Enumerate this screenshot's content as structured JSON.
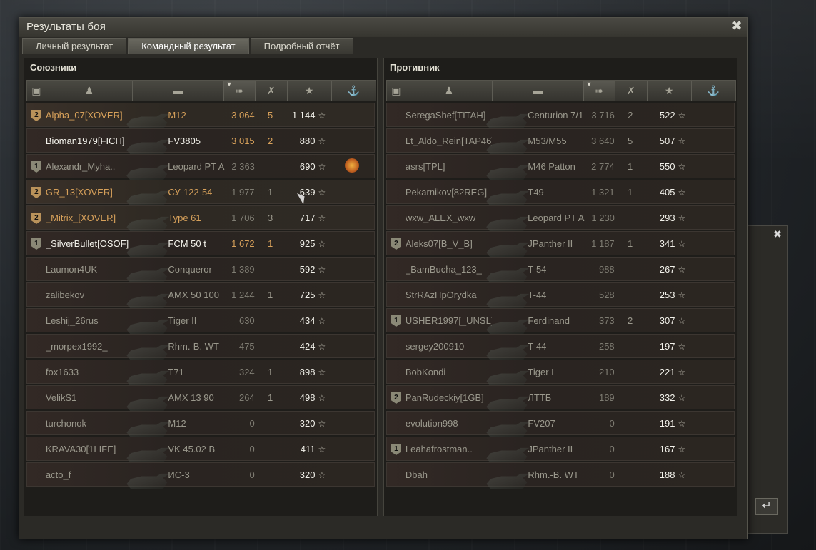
{
  "window": {
    "title": "Результаты боя"
  },
  "tabs": [
    "Личный результат",
    "Командный результат",
    "Подробный отчёт"
  ],
  "active_tab": 1,
  "allies": {
    "title": "Союзники",
    "rows": [
      {
        "badge": "2",
        "badge_color": "gold",
        "player": "Alpha_07[XOVER]",
        "player_color": "gold",
        "tank": "M12",
        "tank_color": "gold",
        "damage": "3 064",
        "damage_color": "gold",
        "kills": "5",
        "xp": "1 144",
        "medal": false,
        "highlight": true
      },
      {
        "badge": "",
        "player": "Bioman1979[FICH]",
        "player_color": "white",
        "tank": "FV3805",
        "tank_color": "white",
        "damage": "3 015",
        "damage_color": "gold",
        "kills": "2",
        "xp": "880",
        "medal": false
      },
      {
        "badge": "1",
        "badge_color": "grey",
        "player": "Alexandr_Myha..",
        "player_color": "dim",
        "tank": "Leopard PT A",
        "tank_color": "dim",
        "damage": "2 363",
        "damage_color": "dim",
        "kills": "",
        "xp": "690",
        "medal": true
      },
      {
        "badge": "2",
        "badge_color": "gold",
        "player": "GR_13[XOVER]",
        "player_color": "gold",
        "tank": "СУ-122-54",
        "tank_color": "gold",
        "damage": "1 977",
        "damage_color": "dim",
        "kills": "1",
        "xp": "639",
        "medal": false,
        "highlight": true
      },
      {
        "badge": "2",
        "badge_color": "gold",
        "player": "_Mitrix_[XOVER]",
        "player_color": "gold",
        "tank": "Type 61",
        "tank_color": "gold",
        "damage": "1 706",
        "damage_color": "dim",
        "kills": "3",
        "xp": "717",
        "medal": false,
        "highlight": true
      },
      {
        "badge": "1",
        "badge_color": "grey",
        "player": "_SilverBullet[OSOF]",
        "player_color": "white",
        "tank": "FCM 50 t",
        "tank_color": "white",
        "damage": "1 672",
        "damage_color": "gold",
        "kills": "1",
        "xp": "925",
        "medal": false
      },
      {
        "badge": "",
        "player": "Laumon4UK",
        "player_color": "dim",
        "tank": "Conqueror",
        "tank_color": "dim",
        "damage": "1 389",
        "damage_color": "dim",
        "kills": "",
        "xp": "592",
        "medal": false
      },
      {
        "badge": "",
        "player": "zalibekov",
        "player_color": "dim",
        "tank": "AMX 50 100",
        "tank_color": "dim",
        "damage": "1 244",
        "damage_color": "dim",
        "kills": "1",
        "xp": "725",
        "medal": false
      },
      {
        "badge": "",
        "player": "Leshij_26rus",
        "player_color": "dim",
        "tank": "Tiger II",
        "tank_color": "dim",
        "damage": "630",
        "damage_color": "dim",
        "kills": "",
        "xp": "434",
        "medal": false
      },
      {
        "badge": "",
        "player": "_morpex1992_",
        "player_color": "dim",
        "tank": "Rhm.-B. WT",
        "tank_color": "dim",
        "damage": "475",
        "damage_color": "dim",
        "kills": "",
        "xp": "424",
        "medal": false
      },
      {
        "badge": "",
        "player": "fox1633",
        "player_color": "dim",
        "tank": "T71",
        "tank_color": "dim",
        "damage": "324",
        "damage_color": "dim",
        "kills": "1",
        "xp": "898",
        "medal": false
      },
      {
        "badge": "",
        "player": "VelikS1",
        "player_color": "dim",
        "tank": "AMX 13 90",
        "tank_color": "dim",
        "damage": "264",
        "damage_color": "dim",
        "kills": "1",
        "xp": "498",
        "medal": false
      },
      {
        "badge": "",
        "player": "turchonok",
        "player_color": "dim",
        "tank": "M12",
        "tank_color": "dim",
        "damage": "0",
        "damage_color": "dim",
        "kills": "",
        "xp": "320",
        "medal": false
      },
      {
        "badge": "",
        "player": "KRAVA30[1LIFE]",
        "player_color": "dim",
        "tank": "VK 45.02 B",
        "tank_color": "dim",
        "damage": "0",
        "damage_color": "dim",
        "kills": "",
        "xp": "411",
        "medal": false
      },
      {
        "badge": "",
        "player": "acto_f",
        "player_color": "dim",
        "tank": "ИС-3",
        "tank_color": "dim",
        "damage": "0",
        "damage_color": "dim",
        "kills": "",
        "xp": "320",
        "medal": false
      }
    ]
  },
  "enemies": {
    "title": "Противник",
    "rows": [
      {
        "badge": "",
        "player": "SeregaShef[TITAH]",
        "player_color": "dim",
        "tank": "Centurion 7/1",
        "tank_color": "dim",
        "damage": "3 716",
        "damage_color": "dim",
        "kills": "2",
        "xp": "522",
        "medal": false
      },
      {
        "badge": "",
        "player": "Lt_Aldo_Rein[TAP46]",
        "player_color": "dim",
        "tank": "M53/M55",
        "tank_color": "dim",
        "damage": "3 640",
        "damage_color": "dim",
        "kills": "5",
        "xp": "507",
        "medal": false
      },
      {
        "badge": "",
        "player": "asrs[TPL]",
        "player_color": "dim",
        "tank": "M46 Patton",
        "tank_color": "dim",
        "damage": "2 774",
        "damage_color": "dim",
        "kills": "1",
        "xp": "550",
        "medal": false
      },
      {
        "badge": "",
        "player": "Pekarnikov[82REG]",
        "player_color": "dim",
        "tank": "T49",
        "tank_color": "dim",
        "damage": "1 321",
        "damage_color": "dim",
        "kills": "1",
        "xp": "405",
        "medal": false
      },
      {
        "badge": "",
        "player": "wxw_ALEX_wxw",
        "player_color": "dim",
        "tank": "Leopard PT A",
        "tank_color": "dim",
        "damage": "1 230",
        "damage_color": "dim",
        "kills": "",
        "xp": "293",
        "medal": false
      },
      {
        "badge": "2",
        "badge_color": "grey",
        "player": "Aleks07[B_V_B]",
        "player_color": "dim",
        "tank": "JPanther II",
        "tank_color": "dim",
        "damage": "1 187",
        "damage_color": "dim",
        "kills": "1",
        "xp": "341",
        "medal": false
      },
      {
        "badge": "",
        "player": "_BamBucha_123_",
        "player_color": "dim",
        "tank": "T-54",
        "tank_color": "dim",
        "damage": "988",
        "damage_color": "dim",
        "kills": "",
        "xp": "267",
        "medal": false
      },
      {
        "badge": "",
        "player": "StrRAzHpOrydka",
        "player_color": "dim",
        "tank": "T-44",
        "tank_color": "dim",
        "damage": "528",
        "damage_color": "dim",
        "kills": "",
        "xp": "253",
        "medal": false
      },
      {
        "badge": "1",
        "badge_color": "grey",
        "player": "USHER1997[_UNSL]",
        "player_color": "dim",
        "tank": "Ferdinand",
        "tank_color": "dim",
        "damage": "373",
        "damage_color": "dim",
        "kills": "2",
        "xp": "307",
        "medal": false
      },
      {
        "badge": "",
        "player": "sergey200910",
        "player_color": "dim",
        "tank": "T-44",
        "tank_color": "dim",
        "damage": "258",
        "damage_color": "dim",
        "kills": "",
        "xp": "197",
        "medal": false
      },
      {
        "badge": "",
        "player": "BobKondi",
        "player_color": "dim",
        "tank": "Tiger I",
        "tank_color": "dim",
        "damage": "210",
        "damage_color": "dim",
        "kills": "",
        "xp": "221",
        "medal": false
      },
      {
        "badge": "2",
        "badge_color": "grey",
        "player": "PanRudeckiy[1GB]",
        "player_color": "dim",
        "tank": "ЛТТБ",
        "tank_color": "dim",
        "damage": "189",
        "damage_color": "dim",
        "kills": "",
        "xp": "332",
        "medal": false
      },
      {
        "badge": "",
        "player": "evolution998",
        "player_color": "dim",
        "tank": "FV207",
        "tank_color": "dim",
        "damage": "0",
        "damage_color": "dim",
        "kills": "",
        "xp": "191",
        "medal": false
      },
      {
        "badge": "1",
        "badge_color": "grey",
        "player": "Leahafrostman..",
        "player_color": "dim",
        "tank": "JPanther II",
        "tank_color": "dim",
        "damage": "0",
        "damage_color": "dim",
        "kills": "",
        "xp": "167",
        "medal": false
      },
      {
        "badge": "",
        "player": "Dbah",
        "player_color": "dim",
        "tank": "Rhm.-B. WT",
        "tank_color": "dim",
        "damage": "0",
        "damage_color": "dim",
        "kills": "",
        "xp": "188",
        "medal": false
      }
    ]
  },
  "colors": {
    "gold": "#d6a05a",
    "white": "#f2f1ea",
    "dim": "#9a988c",
    "panel": "#1e1d1a"
  },
  "icons": {
    "close": "close-icon",
    "squad": "squad-icon",
    "player": "player-icon",
    "tank": "tank-icon",
    "damage": "damage-icon",
    "kills": "kills-icon",
    "xp": "star-icon",
    "medal": "medal-icon"
  }
}
